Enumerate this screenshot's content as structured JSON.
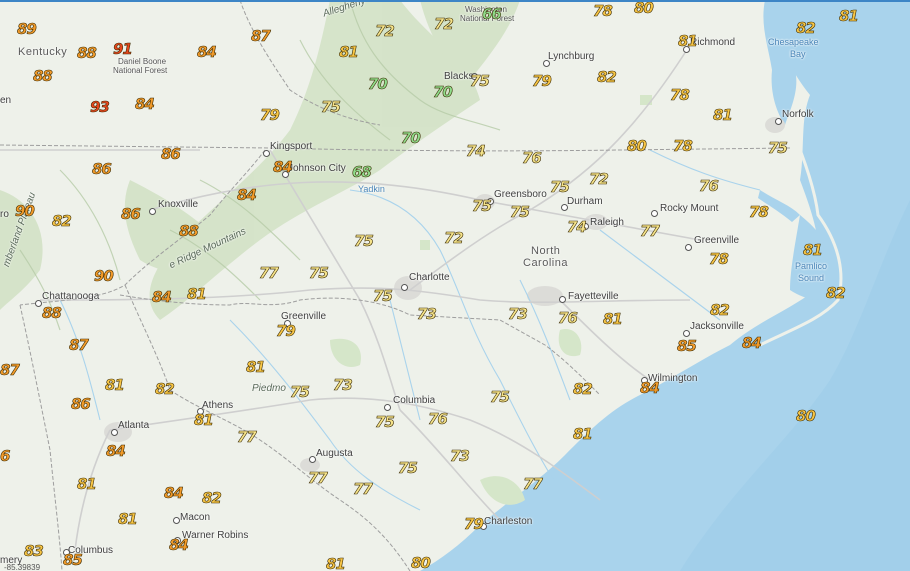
{
  "map": {
    "colors": {
      "land": "#eef1ea",
      "water": "#a9d3ec",
      "mountains": "#cfe0c2",
      "hot_high": "#e8461e",
      "hot": "#f39b2a",
      "warm": "#f7c545",
      "mild": "#f5e38a",
      "cool": "#8fdc8a"
    },
    "places": [
      {
        "id": "kentucky",
        "text": "Kentucky",
        "kind": "state"
      },
      {
        "id": "daniel-boone-1",
        "text": "Daniel Boone",
        "kind": "small"
      },
      {
        "id": "daniel-boone-2",
        "text": "National Forest",
        "kind": "small"
      },
      {
        "id": "allegheny",
        "text": "Allegheny",
        "kind": "mtn"
      },
      {
        "id": "washington-1",
        "text": "Washington",
        "kind": "small"
      },
      {
        "id": "washington-2",
        "text": "National Forest",
        "kind": "small"
      },
      {
        "id": "richmond",
        "text": "Richmond",
        "kind": "city"
      },
      {
        "id": "chesapeake-1",
        "text": "Chesapeake",
        "kind": "water"
      },
      {
        "id": "chesapeake-2",
        "text": "Bay",
        "kind": "water"
      },
      {
        "id": "lynchburg",
        "text": "Lynchburg",
        "kind": "city"
      },
      {
        "id": "blacksburg",
        "text": "Blacks",
        "kind": "city"
      },
      {
        "id": "norfolk",
        "text": "Norfolk",
        "kind": "city"
      },
      {
        "id": "kingsport",
        "text": "Kingsport",
        "kind": "city"
      },
      {
        "id": "johnson-city",
        "text": "Johnson City",
        "kind": "city"
      },
      {
        "id": "yadkin",
        "text": "Yadkin",
        "kind": "water"
      },
      {
        "id": "greensboro",
        "text": "Greensboro",
        "kind": "city"
      },
      {
        "id": "durham",
        "text": "Durham",
        "kind": "city"
      },
      {
        "id": "raleigh",
        "text": "Raleigh",
        "kind": "city"
      },
      {
        "id": "rocky-mount",
        "text": "Rocky Mount",
        "kind": "city"
      },
      {
        "id": "knoxville",
        "text": "Knoxville",
        "kind": "city"
      },
      {
        "id": "greenville-nc",
        "text": "Greenville",
        "kind": "city"
      },
      {
        "id": "north-carolina-1",
        "text": "North",
        "kind": "state"
      },
      {
        "id": "north-carolina-2",
        "text": "Carolina",
        "kind": "state"
      },
      {
        "id": "pamlico-1",
        "text": "Pamlico",
        "kind": "water"
      },
      {
        "id": "pamlico-2",
        "text": "Sound",
        "kind": "water"
      },
      {
        "id": "cumberland",
        "text": "mberland Plateau",
        "kind": "mtn"
      },
      {
        "id": "blue-ridge",
        "text": "e Ridge Mountains",
        "kind": "mtn"
      },
      {
        "id": "charlotte",
        "text": "Charlotte",
        "kind": "city"
      },
      {
        "id": "fayetteville",
        "text": "Fayetteville",
        "kind": "city"
      },
      {
        "id": "chattanooga",
        "text": "Chattanooga",
        "kind": "city"
      },
      {
        "id": "greenville-sc",
        "text": "Greenville",
        "kind": "city"
      },
      {
        "id": "jacksonville",
        "text": "Jacksonville",
        "kind": "city"
      },
      {
        "id": "wilmington",
        "text": "Wilmington",
        "kind": "city"
      },
      {
        "id": "piedmont",
        "text": "Piedmo",
        "kind": "mtn"
      },
      {
        "id": "athens",
        "text": "Athens",
        "kind": "city"
      },
      {
        "id": "columbia",
        "text": "Columbia",
        "kind": "city"
      },
      {
        "id": "atlanta",
        "text": "Atlanta",
        "kind": "city"
      },
      {
        "id": "augusta",
        "text": "Augusta",
        "kind": "city"
      },
      {
        "id": "macon",
        "text": "Macon",
        "kind": "city"
      },
      {
        "id": "warner-robins",
        "text": "Warner Robins",
        "kind": "city"
      },
      {
        "id": "charleston",
        "text": "Charleston",
        "kind": "city"
      },
      {
        "id": "columbus",
        "text": "Columbus",
        "kind": "city"
      },
      {
        "id": "en",
        "text": "en",
        "kind": "city"
      },
      {
        "id": "ro",
        "text": "ro",
        "kind": "city"
      },
      {
        "id": "mery",
        "text": "mery",
        "kind": "city"
      }
    ],
    "temperatures": [
      {
        "id": "t01",
        "value": "89"
      },
      {
        "id": "t02",
        "value": "88"
      },
      {
        "id": "t03",
        "value": "91"
      },
      {
        "id": "t04",
        "value": "84"
      },
      {
        "id": "t05",
        "value": "87"
      },
      {
        "id": "t06",
        "value": "81"
      },
      {
        "id": "t07",
        "value": "72"
      },
      {
        "id": "t08",
        "value": "72"
      },
      {
        "id": "t09",
        "value": "66"
      },
      {
        "id": "t10",
        "value": "78"
      },
      {
        "id": "t11",
        "value": "80"
      },
      {
        "id": "t12",
        "value": "82"
      },
      {
        "id": "t13",
        "value": "81"
      },
      {
        "id": "t14",
        "value": "88"
      },
      {
        "id": "t15",
        "value": "70"
      },
      {
        "id": "t16",
        "value": "70"
      },
      {
        "id": "t17",
        "value": "75"
      },
      {
        "id": "t18",
        "value": "79"
      },
      {
        "id": "t19",
        "value": "82"
      },
      {
        "id": "t20",
        "value": "81"
      },
      {
        "id": "t21",
        "value": "93"
      },
      {
        "id": "t22",
        "value": "84"
      },
      {
        "id": "t23",
        "value": "79"
      },
      {
        "id": "t24",
        "value": "75"
      },
      {
        "id": "t25",
        "value": "78"
      },
      {
        "id": "t26",
        "value": "81"
      },
      {
        "id": "t27",
        "value": "70"
      },
      {
        "id": "t28",
        "value": "74"
      },
      {
        "id": "t29",
        "value": "76"
      },
      {
        "id": "t30",
        "value": "80"
      },
      {
        "id": "t31",
        "value": "78"
      },
      {
        "id": "t32",
        "value": "75"
      },
      {
        "id": "t33",
        "value": "86"
      },
      {
        "id": "t34",
        "value": "86"
      },
      {
        "id": "t35",
        "value": "84"
      },
      {
        "id": "t36",
        "value": "68"
      },
      {
        "id": "t37",
        "value": "75"
      },
      {
        "id": "t38",
        "value": "72"
      },
      {
        "id": "t39",
        "value": "76"
      },
      {
        "id": "t40",
        "value": "84"
      },
      {
        "id": "t41",
        "value": "75"
      },
      {
        "id": "t42",
        "value": "75"
      },
      {
        "id": "t43",
        "value": "78"
      },
      {
        "id": "t44",
        "value": "90"
      },
      {
        "id": "t45",
        "value": "82"
      },
      {
        "id": "t46",
        "value": "86"
      },
      {
        "id": "t47",
        "value": "88"
      },
      {
        "id": "t48",
        "value": "75"
      },
      {
        "id": "t49",
        "value": "72"
      },
      {
        "id": "t50",
        "value": "74"
      },
      {
        "id": "t51",
        "value": "77"
      },
      {
        "id": "t52",
        "value": "81"
      },
      {
        "id": "t53",
        "value": "78"
      },
      {
        "id": "t54",
        "value": "90"
      },
      {
        "id": "t55",
        "value": "77"
      },
      {
        "id": "t56",
        "value": "75"
      },
      {
        "id": "t57",
        "value": "84"
      },
      {
        "id": "t58",
        "value": "81"
      },
      {
        "id": "t59",
        "value": "75"
      },
      {
        "id": "t60",
        "value": "88"
      },
      {
        "id": "t61",
        "value": "73"
      },
      {
        "id": "t62",
        "value": "73"
      },
      {
        "id": "t63",
        "value": "76"
      },
      {
        "id": "t64",
        "value": "81"
      },
      {
        "id": "t65",
        "value": "82"
      },
      {
        "id": "t66",
        "value": "82"
      },
      {
        "id": "t67",
        "value": "79"
      },
      {
        "id": "t68",
        "value": "85"
      },
      {
        "id": "t69",
        "value": "84"
      },
      {
        "id": "t70",
        "value": "87"
      },
      {
        "id": "t71",
        "value": "81"
      },
      {
        "id": "t72",
        "value": "87"
      },
      {
        "id": "t73",
        "value": "81"
      },
      {
        "id": "t74",
        "value": "82"
      },
      {
        "id": "t75",
        "value": "75"
      },
      {
        "id": "t76",
        "value": "73"
      },
      {
        "id": "t77",
        "value": "84"
      },
      {
        "id": "t78",
        "value": "86"
      },
      {
        "id": "t79",
        "value": "81"
      },
      {
        "id": "t80",
        "value": "75"
      },
      {
        "id": "t81",
        "value": "76"
      },
      {
        "id": "t82",
        "value": "75"
      },
      {
        "id": "t83",
        "value": "82"
      },
      {
        "id": "t84",
        "value": "80"
      },
      {
        "id": "t85",
        "value": "84"
      },
      {
        "id": "t86",
        "value": "77"
      },
      {
        "id": "t87",
        "value": "81"
      },
      {
        "id": "t88",
        "value": "6"
      },
      {
        "id": "t89",
        "value": "77"
      },
      {
        "id": "t90",
        "value": "75"
      },
      {
        "id": "t91",
        "value": "73"
      },
      {
        "id": "t92",
        "value": "77"
      },
      {
        "id": "t93",
        "value": "81"
      },
      {
        "id": "t94",
        "value": "84"
      },
      {
        "id": "t95",
        "value": "82"
      },
      {
        "id": "t96",
        "value": "77"
      },
      {
        "id": "t97",
        "value": "81"
      },
      {
        "id": "t98",
        "value": "79"
      },
      {
        "id": "t99",
        "value": "84"
      },
      {
        "id": "t100",
        "value": "83"
      },
      {
        "id": "t101",
        "value": "85"
      },
      {
        "id": "t102",
        "value": "81"
      },
      {
        "id": "t103",
        "value": "80"
      }
    ],
    "credit": "-85.39839"
  }
}
